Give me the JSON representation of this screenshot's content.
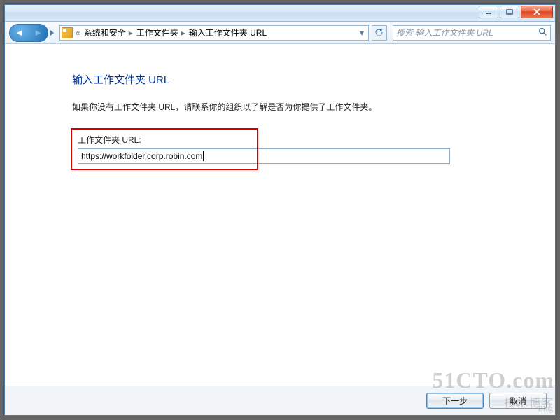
{
  "titlebar": {
    "minimize": "minimize",
    "maximize": "maximize",
    "close": "close"
  },
  "breadcrumb": {
    "lead": "«",
    "items": [
      "系统和安全",
      "工作文件夹",
      "输入工作文件夹 URL"
    ]
  },
  "search_placeholder": "搜索 输入工作文件夹 URL",
  "heading": "输入工作文件夹 URL",
  "description": "如果你没有工作文件夹 URL，请联系你的组织以了解是否为你提供了工作文件夹。",
  "field_label": "工作文件夹 URL:",
  "field_value": "https://workfolder.corp.robin.com",
  "buttons": {
    "next": "下一步",
    "cancel": "取消"
  },
  "watermark": {
    "line1": "51CTO.com",
    "line2": "技术博客",
    "blog": "Blog"
  }
}
